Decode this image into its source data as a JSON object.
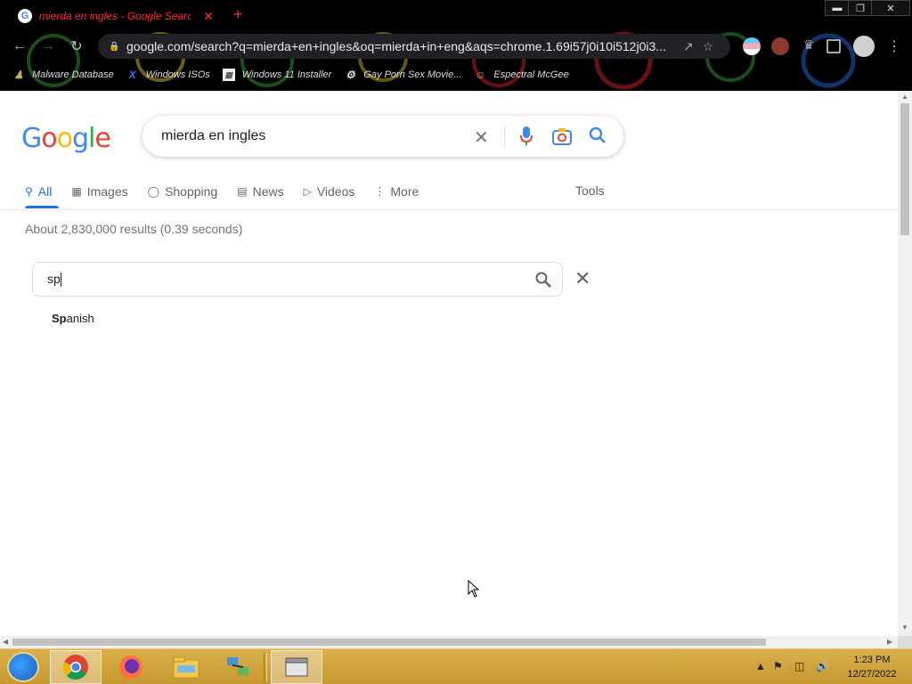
{
  "browser": {
    "tab_title": "mierda en ingles - Google Search",
    "tab_close": "✕",
    "new_tab": "+",
    "url": "google.com/search?q=mierda+en+ingles&oq=mierda+in+eng&aqs=chrome.1.69i57j0i10i512j0i3...",
    "window_controls": {
      "minimize": "▬",
      "restore": "❐",
      "close": "✕"
    },
    "bookmarks": [
      {
        "label": "Malware Database",
        "icon": "person-icon"
      },
      {
        "label": "Windows ISOs",
        "icon": "x-logo-icon"
      },
      {
        "label": "Windows 11 Installer",
        "icon": "image-icon"
      },
      {
        "label": "Gay Porn Sex Movie...",
        "icon": "site-icon"
      },
      {
        "label": "Espectral McGee",
        "icon": "avatar-icon"
      }
    ]
  },
  "google": {
    "logo_letters": [
      "G",
      "o",
      "o",
      "g",
      "l",
      "e"
    ],
    "logo_colors": [
      "#4285f4",
      "#ea4335",
      "#fbbc05",
      "#4285f4",
      "#34a853",
      "#ea4335"
    ],
    "query": "mierda en ingles",
    "tabs": [
      {
        "label": "All",
        "icon": "search-icon",
        "active": true
      },
      {
        "label": "Images",
        "icon": "image-icon"
      },
      {
        "label": "Shopping",
        "icon": "tag-icon"
      },
      {
        "label": "News",
        "icon": "newspaper-icon"
      },
      {
        "label": "Videos",
        "icon": "play-icon"
      },
      {
        "label": "More",
        "icon": "vertical-dots-icon"
      }
    ],
    "tools_label": "Tools",
    "result_stats": "About 2,830,000 results (0.39 seconds)",
    "translate_input_value": "sp",
    "suggestion_bold": "Sp",
    "suggestion_rest": "anish"
  },
  "taskbar": {
    "time": "1:23 PM",
    "date": "12/27/2022",
    "apps": [
      "chrome",
      "firefox",
      "file-explorer",
      "network-app",
      "archive-app"
    ]
  },
  "colors": {
    "google_blue": "#1a73e8",
    "tab_text_red": "#ff2a2a",
    "taskbar_gold": "#c6982f"
  }
}
